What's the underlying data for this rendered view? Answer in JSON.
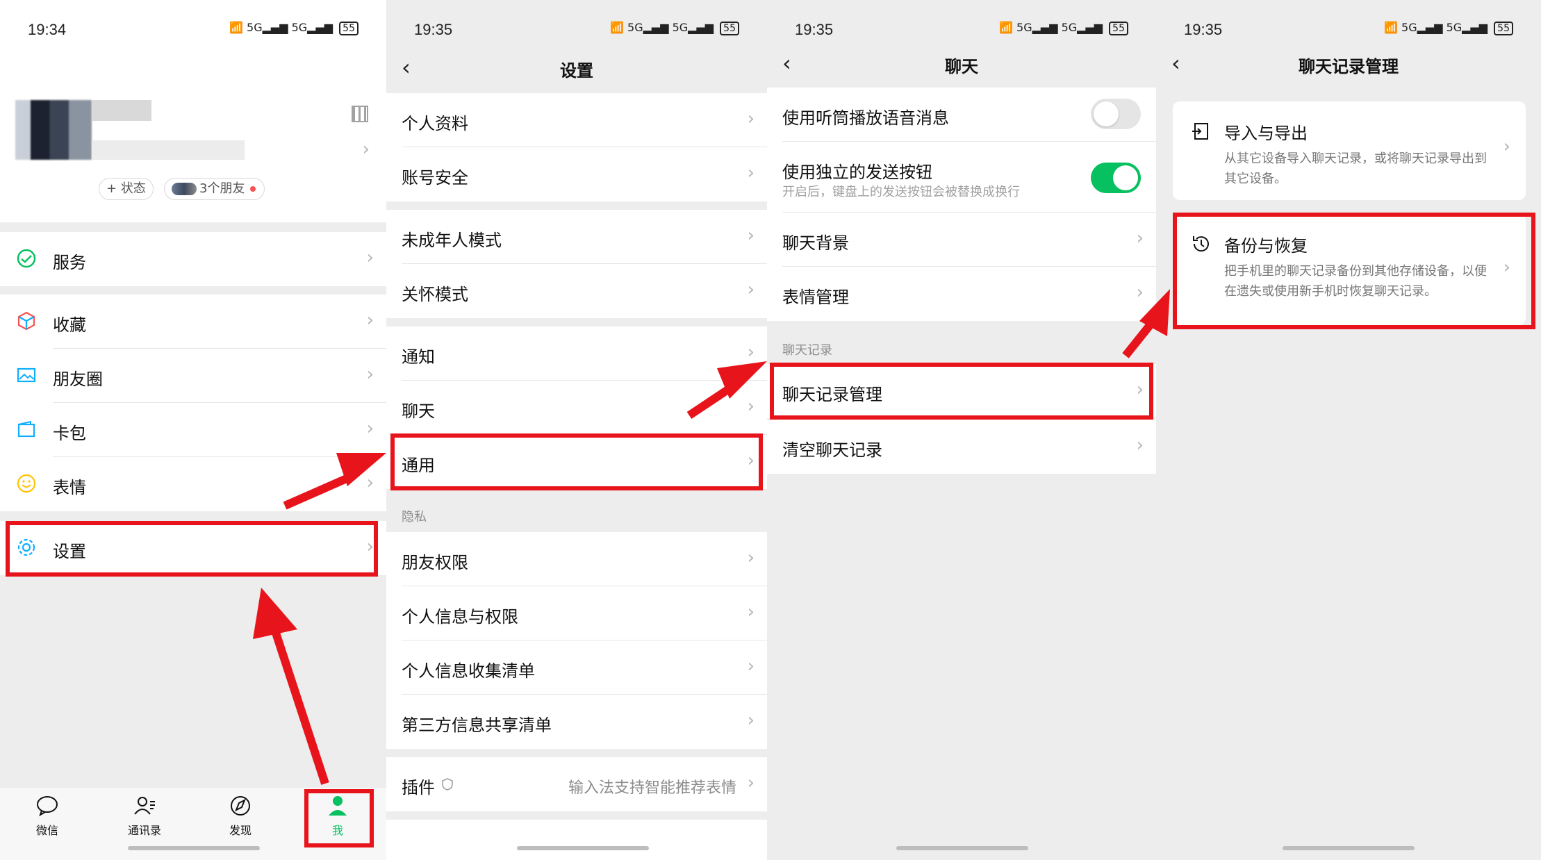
{
  "panel1": {
    "time": "19:34",
    "battery": "55",
    "status_pill": "+ 状态",
    "friends_pill": "3个朋友",
    "menu": {
      "service": "服务",
      "favorites": "收藏",
      "moments": "朋友圈",
      "cards": "卡包",
      "stickers": "表情",
      "settings": "设置"
    },
    "tabs": [
      "微信",
      "通讯录",
      "发现",
      "我"
    ]
  },
  "panel2": {
    "time": "19:35",
    "battery": "55",
    "title": "设置",
    "items": {
      "profile": "个人资料",
      "account_security": "账号安全",
      "minor_mode": "未成年人模式",
      "care_mode": "关怀模式",
      "notifications": "通知",
      "chat": "聊天",
      "general": "通用",
      "privacy_header": "隐私",
      "friend_permissions": "朋友权限",
      "personal_info_permissions": "个人信息与权限",
      "info_collection_list": "个人信息收集清单",
      "third_party_list": "第三方信息共享清单",
      "plugins": "插件",
      "plugins_value": "输入法支持智能推荐表情"
    }
  },
  "panel3": {
    "time": "19:35",
    "battery": "55",
    "title": "聊天",
    "items": {
      "earpiece": "使用听筒播放语音消息",
      "send_button": "使用独立的发送按钮",
      "send_button_sub": "开启后，键盘上的发送按钮会被替换成换行",
      "chat_background": "聊天背景",
      "sticker_management": "表情管理",
      "history_header": "聊天记录",
      "history_management": "聊天记录管理",
      "clear_history": "清空聊天记录"
    },
    "toggles": {
      "earpiece": false,
      "send_button": true
    }
  },
  "panel4": {
    "time": "19:35",
    "battery": "55",
    "title": "聊天记录管理",
    "import_export": {
      "title": "导入与导出",
      "desc": "从其它设备导入聊天记录，或将聊天记录导出到其它设备。"
    },
    "backup_restore": {
      "title": "备份与恢复",
      "desc": "把手机里的聊天记录备份到其他存储设备，以便在遗失或使用新手机时恢复聊天记录。"
    }
  },
  "colors": {
    "highlight_red": "#e8141b",
    "wechat_green": "#07c160",
    "background": "#ededed"
  }
}
